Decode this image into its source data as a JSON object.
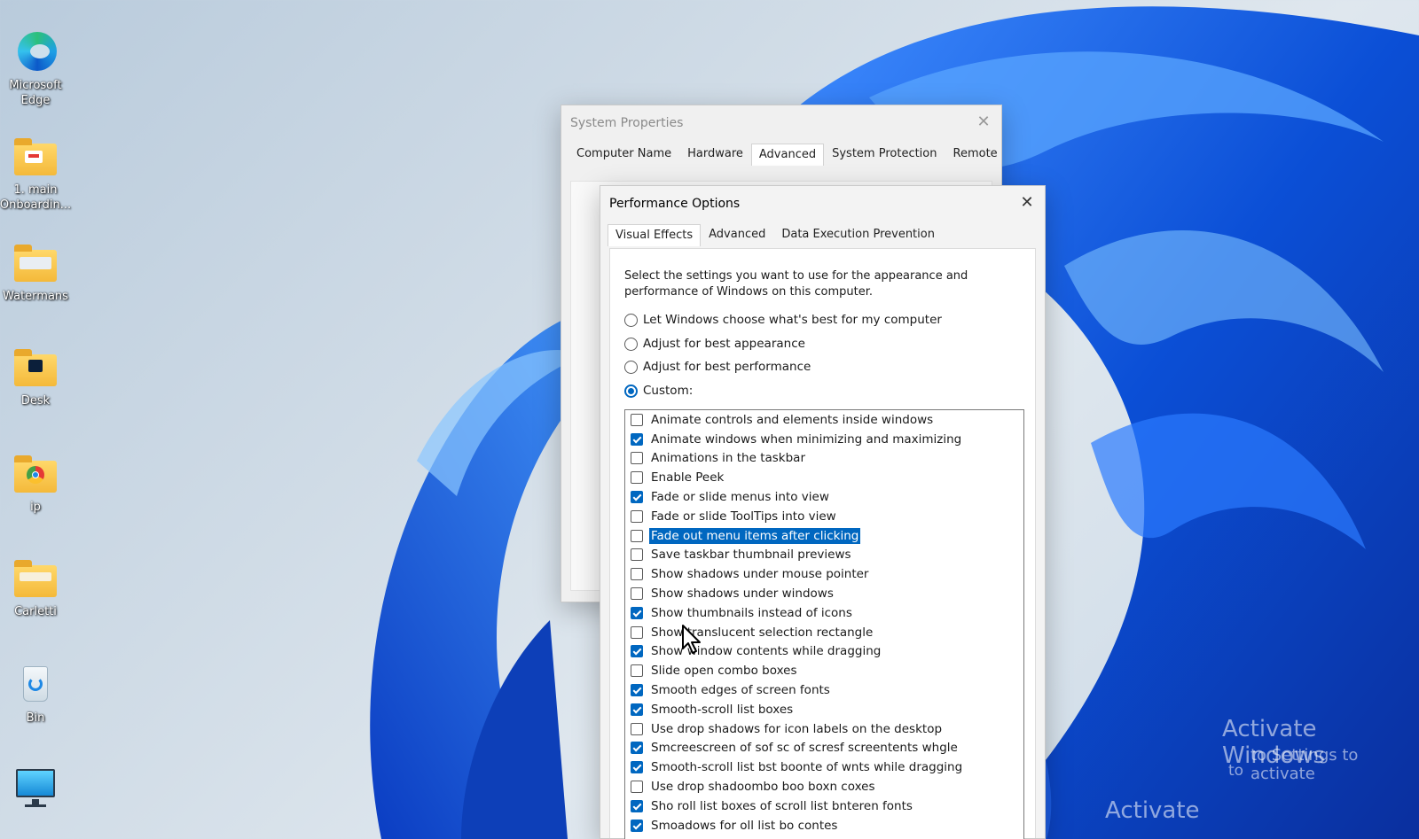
{
  "desktop": {
    "icons": [
      {
        "name": "edge",
        "label_line1": "Microsoft",
        "label_line2": "Edge",
        "icon": "edge-icon"
      },
      {
        "name": "main-onboarding",
        "label_line1": "1. main",
        "label_line2": "Onboardin...",
        "icon": "folder-icon"
      },
      {
        "name": "watermans",
        "label_line1": "Watermans",
        "label_line2": "",
        "icon": "folder-icon"
      },
      {
        "name": "desk",
        "label_line1": "Desk",
        "label_line2": "",
        "icon": "folder-icon"
      },
      {
        "name": "ip",
        "label_line1": "ip",
        "label_line2": "",
        "icon": "folder-icon"
      },
      {
        "name": "carletti",
        "label_line1": "Carletti",
        "label_line2": "",
        "icon": "folder-icon"
      },
      {
        "name": "bin",
        "label_line1": "Bin",
        "label_line2": "",
        "icon": "recycle-bin-icon"
      },
      {
        "name": "this-pc",
        "label_line1": "",
        "label_line2": "",
        "icon": "monitor-icon"
      }
    ]
  },
  "system_properties": {
    "title": "System Properties",
    "tabs": [
      "Computer Name",
      "Hardware",
      "Advanced",
      "System Protection",
      "Remote"
    ],
    "active_tab": "Advanced"
  },
  "performance_options": {
    "title": "Performance Options",
    "tabs": [
      "Visual Effects",
      "Advanced",
      "Data Execution Prevention"
    ],
    "active_tab": "Visual Effects",
    "intro": "Select the settings you want to use for the appearance and performance of Windows on this computer.",
    "radios": [
      {
        "label": "Let Windows choose what's best for my computer",
        "checked": false
      },
      {
        "label": "Adjust for best appearance",
        "checked": false
      },
      {
        "label": "Adjust for best performance",
        "checked": false
      },
      {
        "label": "Custom:",
        "checked": true
      }
    ],
    "effects": [
      {
        "label": "Animate controls and elements inside windows",
        "checked": false
      },
      {
        "label": "Animate windows when minimizing and maximizing",
        "checked": true
      },
      {
        "label": "Animations in the taskbar",
        "checked": false
      },
      {
        "label": "Enable Peek",
        "checked": false
      },
      {
        "label": "Fade or slide menus into view",
        "checked": true
      },
      {
        "label": "Fade or slide ToolTips into view",
        "checked": false
      },
      {
        "label": "Fade out menu items after clicking",
        "checked": false,
        "selected": true
      },
      {
        "label": "Save taskbar thumbnail previews",
        "checked": false
      },
      {
        "label": "Show shadows under mouse pointer",
        "checked": false
      },
      {
        "label": "Show shadows under windows",
        "checked": false
      },
      {
        "label": "Show thumbnails instead of icons",
        "checked": true
      },
      {
        "label": "Show translucent selection rectangle",
        "checked": false
      },
      {
        "label": "Show window contents while dragging",
        "checked": true
      },
      {
        "label": "Slide open combo boxes",
        "checked": false
      },
      {
        "label": "Smooth edges of screen fonts",
        "checked": true
      },
      {
        "label": "Smooth-scroll list boxes",
        "checked": true
      },
      {
        "label": "Use drop shadows for icon labels on the desktop",
        "checked": false
      },
      {
        "label": "Smcreescreen of sof sc of scresf screentents whgle",
        "checked": true
      },
      {
        "label": "Smooth-scroll list bst boonte of wnts while dragging",
        "checked": true
      },
      {
        "label": "Use drop shadoombo boo boxn coxes",
        "checked": false
      },
      {
        "label": "Sho roll list boxes of scroll list bnteren fonts",
        "checked": true
      },
      {
        "label": "Smoadows for oll list bo contes",
        "checked": true
      }
    ]
  },
  "watermark": {
    "line1": "Activate Windows",
    "line2": "to Settings to activate",
    "line3": "to",
    "line4": "Activate"
  }
}
